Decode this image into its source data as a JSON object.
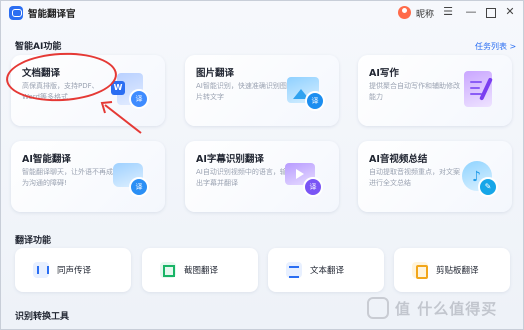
{
  "window": {
    "title": "智能翻译官",
    "user_name": "昵称",
    "controls": {
      "menu": "☰",
      "minimize": "—",
      "close": "✕"
    }
  },
  "ai_section": {
    "title": "智能AI功能",
    "task_link": "任务列表 >",
    "cards": [
      {
        "title": "文档翻译",
        "desc": "高保真排版，支持PDF、Word等多格式",
        "badge": "译"
      },
      {
        "title": "图片翻译",
        "desc": "AI智能识别，快速准确识别图片转文字",
        "badge": "译"
      },
      {
        "title": "AI写作",
        "desc": "提供聚合自动写作和辅助修改能力"
      },
      {
        "title": "AI智能翻译",
        "desc": "智能翻译聊天，让外语不再成为沟通的障碍!",
        "badge": "译"
      },
      {
        "title": "AI字幕识别翻译",
        "desc": "AI自动识别视频中的语言，输出字幕并翻译",
        "badge": "译"
      },
      {
        "title": "AI音视频总结",
        "desc": "自动提取音视频重点，对文案进行全文总结"
      }
    ]
  },
  "translate_section": {
    "title": "翻译功能",
    "items": [
      {
        "label": "同声传译",
        "icon": "voice-icon"
      },
      {
        "label": "截图翻译",
        "icon": "screenshot-icon"
      },
      {
        "label": "文本翻译",
        "icon": "text-icon"
      },
      {
        "label": "剪贴板翻译",
        "icon": "clipboard-icon"
      }
    ]
  },
  "convert_section": {
    "title": "识别转换工具"
  },
  "watermark": {
    "text": "值 什么值得买"
  },
  "colors": {
    "accent": "#2b6ef2",
    "annotation": "#e53935"
  }
}
